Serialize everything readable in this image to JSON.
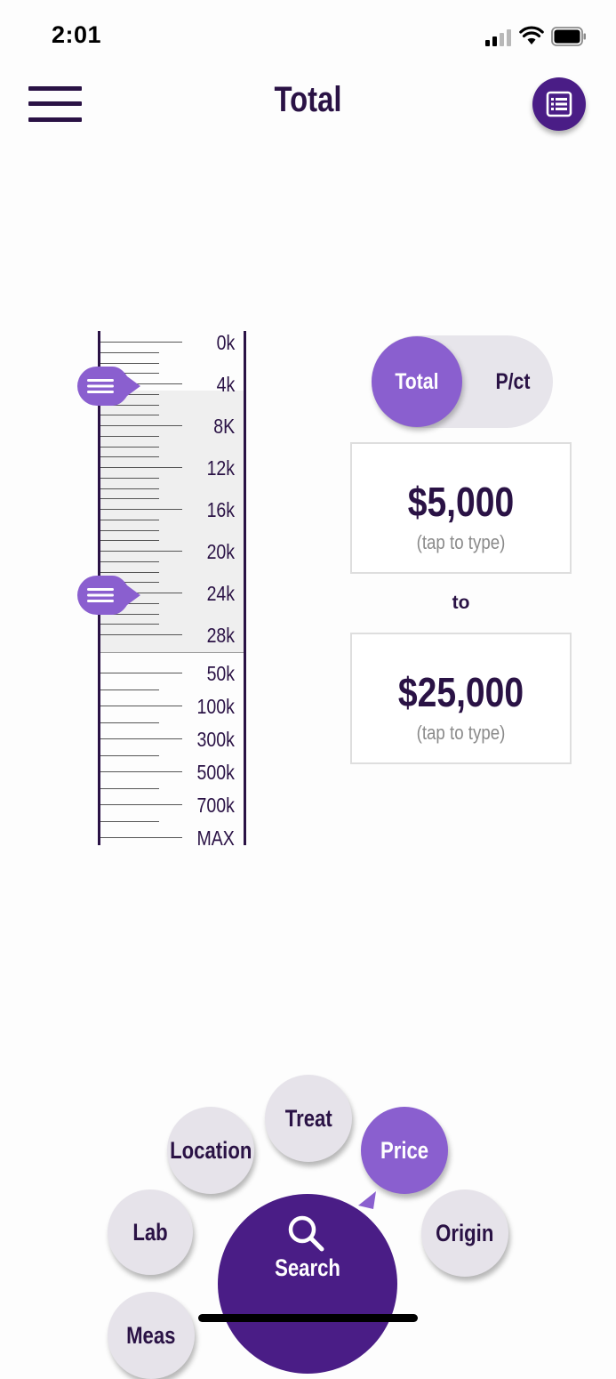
{
  "status_bar": {
    "time": "2:01"
  },
  "header": {
    "title": "Total",
    "menu_icon": "hamburger-icon",
    "list_icon": "list-icon"
  },
  "slider": {
    "labels": [
      "0k",
      "4k",
      "8K",
      "12k",
      "16k",
      "20k",
      "24k",
      "28k",
      "50k",
      "100k",
      "300k",
      "500k",
      "700k",
      "MAX"
    ],
    "range_min": 5000,
    "range_max": 25000,
    "handle_icon": "drag-handle-icon"
  },
  "mode_toggle": {
    "options": [
      "Total",
      "P/ct"
    ],
    "selected": "Total"
  },
  "price_range": {
    "from": {
      "value": "$5,000",
      "hint": "(tap to type)"
    },
    "to_label": "to",
    "to": {
      "value": "$25,000",
      "hint": "(tap to type)"
    }
  },
  "bottom_menu": {
    "items": [
      {
        "label": "Location"
      },
      {
        "label": "Treat"
      },
      {
        "label": "Price",
        "active": true
      },
      {
        "label": "Lab"
      },
      {
        "label": "Origin"
      },
      {
        "label": "Meas"
      }
    ],
    "search_label": "Search",
    "search_icon": "search-icon"
  },
  "colors": {
    "primary_dark": "#4a1d86",
    "accent": "#8a5fcf",
    "text": "#2a1245",
    "button_bg": "#e6e3ea"
  }
}
